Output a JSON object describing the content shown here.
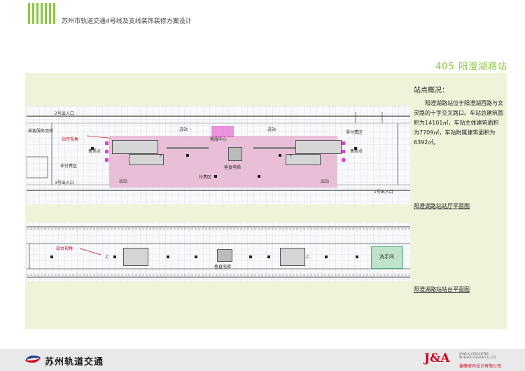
{
  "header": {
    "doc_title": "苏州市轨道交通4号线及支线装饰装修方案设计",
    "station_title": "405 阳澄湖路站"
  },
  "overview": {
    "heading": "站点概况：",
    "paragraph": "阳澄湖路站位于阳澄湖西路与文灵路的十字交叉路口。车站总建筑面积为14101㎡，车站主体建筑面积为7709㎡，车站附属建筑面积为6392㎡。"
  },
  "hall_plan": {
    "caption": "阳澄湖路站站厅平面图",
    "labels": {
      "exit2": "2号出入口",
      "service_room": "乘客服务用房",
      "view": "站厅视角",
      "ticket_l": "售票点",
      "unpaid_l": "非付费区",
      "exit3": "3号出入口",
      "enter_l": "进站",
      "enter_r": "进站",
      "service_center": "客服中心",
      "down_l": "下",
      "down_r": "下",
      "elevator": "垂直电梯",
      "exit_l": "出站",
      "exit_r": "出站",
      "paid": "付费区",
      "unpaid_r": "非付费区",
      "ticket_r": "售票点",
      "exit1": "1号出入口"
    }
  },
  "platform_plan": {
    "caption": "阳澄湖路站站台平面图",
    "labels": {
      "view": "站台视角",
      "up_l": "上",
      "up_r": "上",
      "elevator": "垂直电梯",
      "washroom": "洗手间"
    }
  },
  "footer": {
    "brand": "苏州轨道交通",
    "ja_logo": "J&A",
    "ja_name1": "JIANG & ASSOCIATES",
    "ja_name2": "INTERIOR DESIGN CO.,LTD",
    "ja_cn": "姜峰室内设计有限公司"
  },
  "colors": {
    "accent": "#8cc63f",
    "paid_zone": "#e7b8d4",
    "machine": "#e040c8",
    "ja_red": "#d0021b"
  }
}
